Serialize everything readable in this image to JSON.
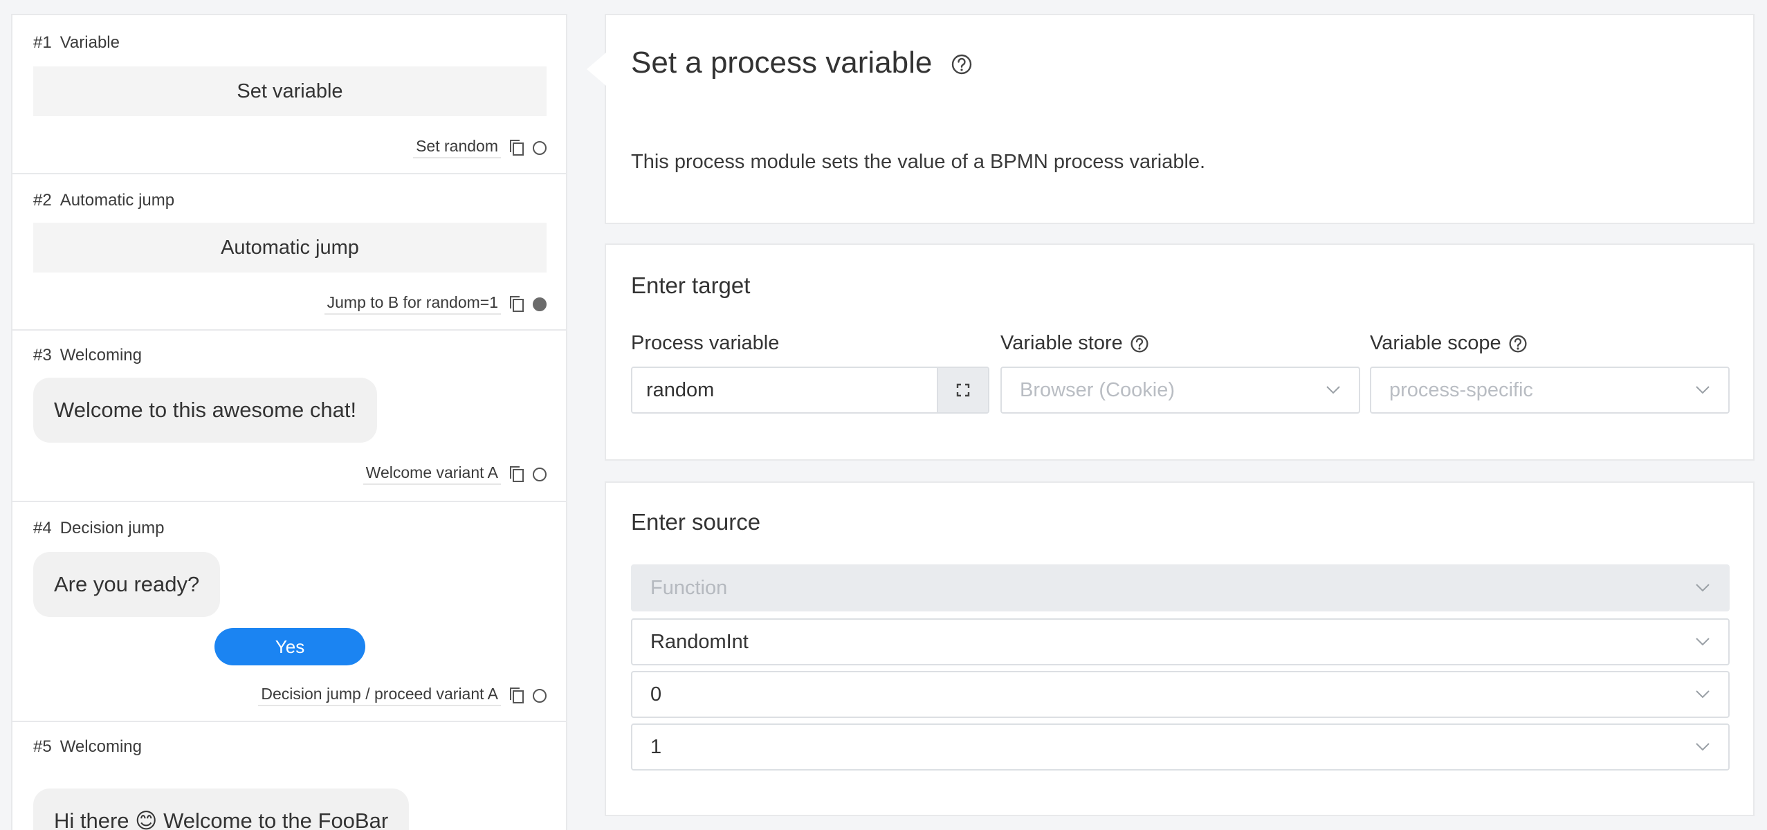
{
  "steps": [
    {
      "num": "#1",
      "type": "Variable",
      "action": "Set variable",
      "footer": "Set random",
      "selected": false
    },
    {
      "num": "#2",
      "type": "Automatic jump",
      "action": "Automatic jump",
      "footer": "Jump to B for random=1",
      "selected": true
    },
    {
      "num": "#3",
      "type": "Welcoming",
      "message": "Welcome to this awesome chat!",
      "footer": "Welcome variant A",
      "selected": false
    },
    {
      "num": "#4",
      "type": "Decision jump",
      "message": "Are you ready?",
      "button": "Yes",
      "footer": "Decision jump / proceed variant A",
      "selected": false
    },
    {
      "num": "#5",
      "type": "Welcoming",
      "message": "Hi there 😊 Welcome to the FooBar"
    }
  ],
  "header": {
    "title": "Set a process variable",
    "description": "This process module sets the value of a BPMN process variable."
  },
  "target": {
    "section_title": "Enter target",
    "process_variable_label": "Process variable",
    "process_variable_value": "random",
    "variable_store_label": "Variable store",
    "variable_store_value": "Browser (Cookie)",
    "variable_scope_label": "Variable scope",
    "variable_scope_value": "process-specific"
  },
  "source": {
    "section_title": "Enter source",
    "type_value": "Function",
    "function_value": "RandomInt",
    "arg1_value": "0",
    "arg2_value": "1"
  },
  "colors": {
    "accent": "#1b84f2",
    "card_border": "#e8e9eb",
    "page_bg": "#f4f5f7"
  },
  "icons": [
    "copy-icon",
    "radio-icon",
    "help-icon",
    "expand-icon",
    "chevron-down-icon"
  ]
}
